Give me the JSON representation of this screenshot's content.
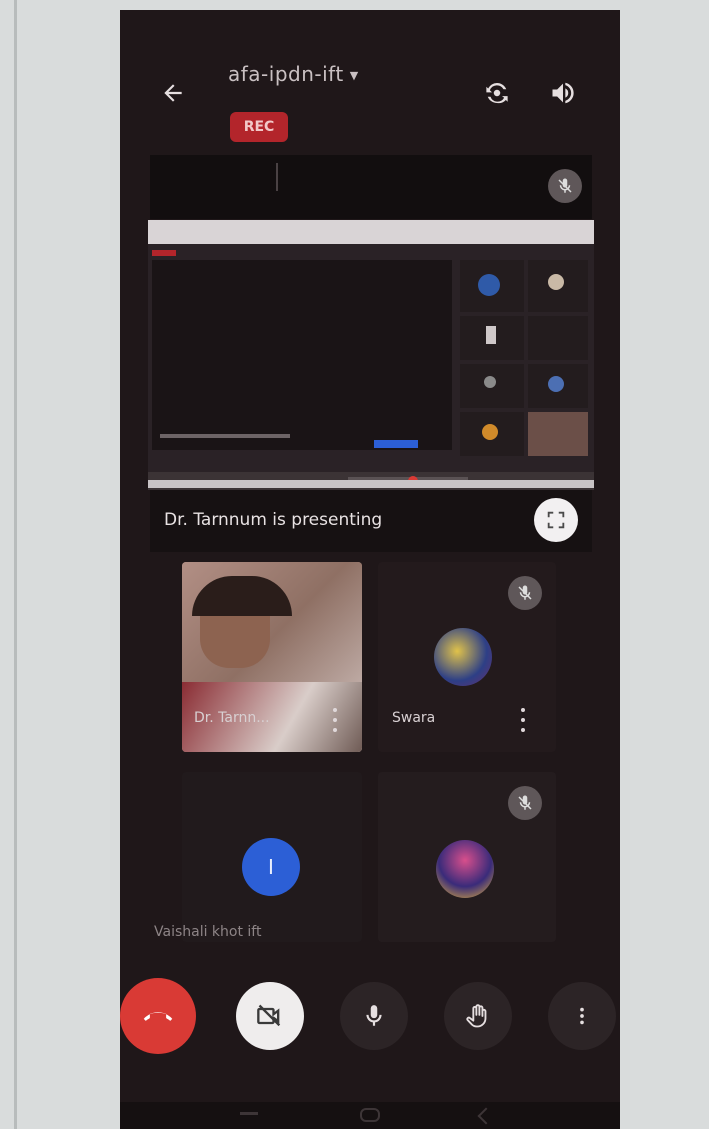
{
  "meeting": {
    "code": "afa-ipdn-ift",
    "rec_label": "REC"
  },
  "presentation": {
    "presenting_text": "Dr. Tarnnum is presenting"
  },
  "participants": [
    {
      "name": "Dr. Tarnn...",
      "type": "video"
    },
    {
      "name": "Swara",
      "type": "avatar-image"
    },
    {
      "name": "Vaishali khot ift",
      "initial": "I",
      "type": "initial-avatar"
    },
    {
      "name": "",
      "type": "avatar-image"
    }
  ],
  "colors": {
    "background": "#1f1719",
    "rec_red": "#b3252b",
    "end_call_red": "#d93a35",
    "avatar_blue": "#2c5fd6",
    "control_dark": "#2c2426",
    "control_light": "#efeded"
  },
  "icons": {
    "back": "arrow-left",
    "switch_camera": "camera-switch",
    "audio": "speaker",
    "fullscreen": "expand",
    "end_call": "phone-hangup",
    "camera_off": "video-off",
    "mic": "microphone",
    "raise_hand": "hand",
    "more": "more-vertical"
  }
}
